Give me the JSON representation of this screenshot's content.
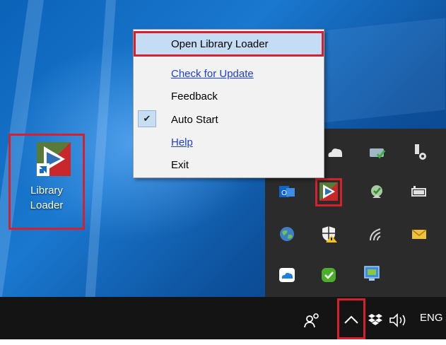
{
  "desktop_icon": {
    "label_line1": "Library",
    "label_line2": "Loader"
  },
  "context_menu": {
    "items": [
      {
        "label": "Open Library Loader",
        "highlighted": true
      },
      {
        "label": "Check for Update",
        "link": true
      },
      {
        "label": "Feedback"
      },
      {
        "label": "Auto Start",
        "checked": true,
        "check_glyph": "✔"
      },
      {
        "label": "Help",
        "link": true
      },
      {
        "label": "Exit"
      }
    ]
  },
  "tray_icons": [
    "onedrive-icon",
    "network-status-icon",
    "usb-device-icon",
    "outlook-icon",
    "library-loader-tray-icon",
    "network-check-icon",
    "battery-icon",
    "globe-icon",
    "windows-security-icon",
    "wifi-icon",
    "mail-icon",
    "cloud-icon",
    "green-check-icon",
    "display-icon"
  ],
  "taskbar": {
    "language": "ENG",
    "people_icon": "people-icon",
    "overflow_glyph": "︿",
    "dropbox_icon": "dropbox-icon",
    "volume_icon": "volume-icon"
  },
  "colors": {
    "highlight_red": "#d6202e",
    "menu_hover": "#c5dcf5",
    "link_blue": "#1f40d6"
  }
}
